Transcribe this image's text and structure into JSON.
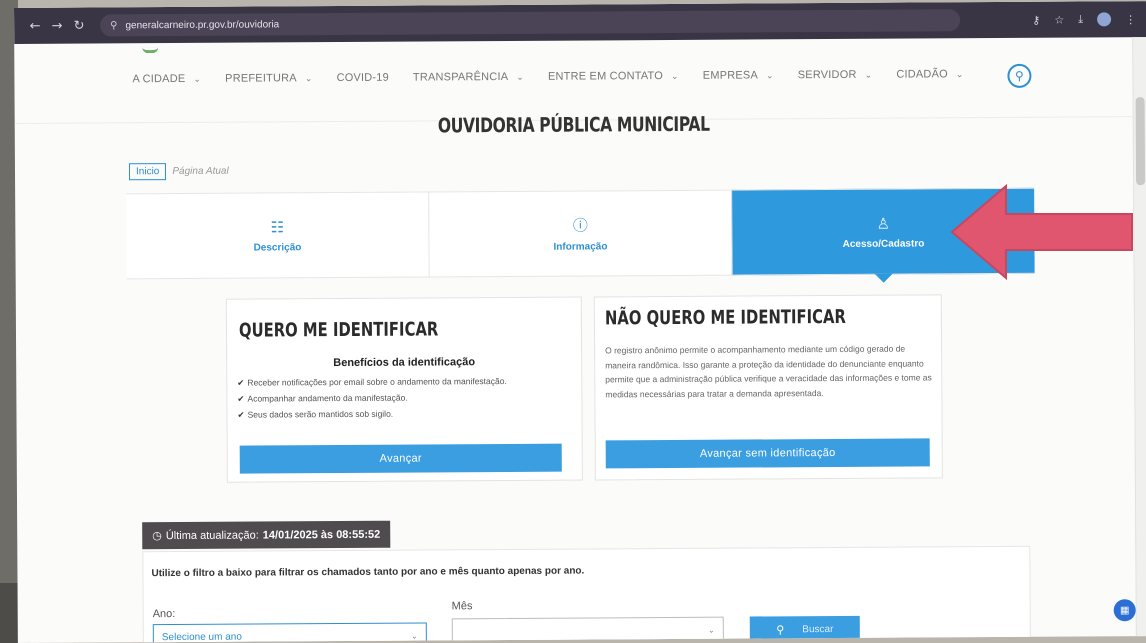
{
  "browser": {
    "url": "generalcarneiro.pr.gov.br/ouvidoria",
    "back_icon": "←",
    "forward_icon": "→",
    "reload_icon": "↻",
    "site_info_icon": "⚲",
    "key_icon": "⚷",
    "star_icon": "☆",
    "download_icon": "⤓",
    "menu_icon": "⋮"
  },
  "nav": {
    "items": [
      {
        "label": "A CIDADE",
        "chevron": true
      },
      {
        "label": "PREFEITURA",
        "chevron": true
      },
      {
        "label": "COVID-19",
        "chevron": false
      },
      {
        "label": "TRANSPARÊNCIA",
        "chevron": true
      },
      {
        "label": "ENTRE EM CONTATO",
        "chevron": true
      },
      {
        "label": "EMPRESA",
        "chevron": true
      },
      {
        "label": "SERVIDOR",
        "chevron": true
      },
      {
        "label": "CIDADÃO",
        "chevron": true
      }
    ],
    "chevron_glyph": "⌄",
    "search_glyph": "⚲"
  },
  "page": {
    "title": "OUVIDORIA PÚBLICA MUNICIPAL",
    "breadcrumb_home": "Inicio",
    "breadcrumb_current": "Página Atual"
  },
  "tabs": [
    {
      "label": "Descrição",
      "icon": "☷",
      "active": false
    },
    {
      "label": "Informação",
      "icon": "ⓘ",
      "active": false
    },
    {
      "label": "Acesso/Cadastro",
      "icon": "♙",
      "active": true
    }
  ],
  "identify": {
    "title": "QUERO ME IDENTIFICAR",
    "benefits_heading": "Benefícios da identificação",
    "benefits": [
      "Receber notificações por email sobre o andamento da manifestação.",
      "Acompanhar andamento da manifestação.",
      "Seus dados serão mantidos sob sigilo."
    ],
    "check_glyph": "✔",
    "button": "Avançar"
  },
  "anonymous": {
    "title": "NÃO QUERO ME IDENTIFICAR",
    "text": "O registro anônimo permite o acompanhamento mediante um código gerado de maneira randômica. Isso garante a proteção da identidade do denunciante enquanto permite que a administração pública verifique a veracidade das informações e tome as medidas necessárias para tratar a demanda apresentada.",
    "button": "Avançar sem identificação"
  },
  "update": {
    "clock_icon": "◷",
    "label": "Última atualização:",
    "value": "14/01/2025 às 08:55:52"
  },
  "filter": {
    "intro": "Utilize o filtro a baixo para filtrar os chamados tanto por ano e mês quanto apenas por ano.",
    "year_label": "Ano:",
    "year_placeholder": "Selecione um ano",
    "month_label": "Mês",
    "month_value": "",
    "caret": "⌄",
    "search_icon": "⚲",
    "search_button": "Buscar"
  },
  "float_button_icon": "▦",
  "colors": {
    "accent": "#2e99dc",
    "arrow": "#e0566e",
    "chrome": "#3a3544",
    "badge": "#4f4b4f"
  }
}
